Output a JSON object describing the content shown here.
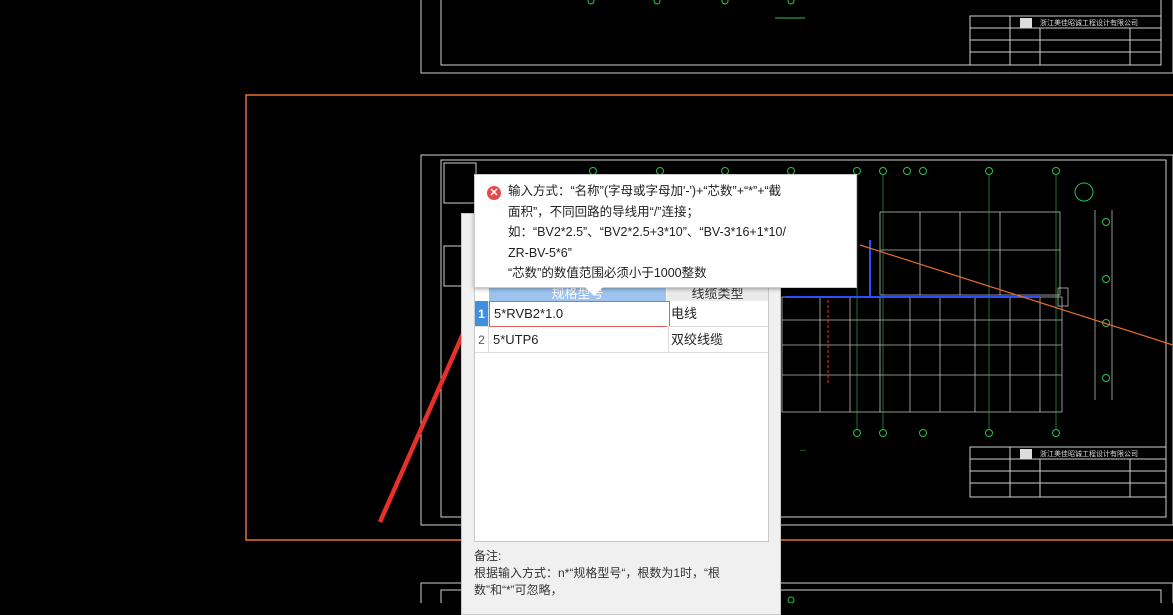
{
  "cad_titleblock": {
    "company": "浙江美佳昭诚工程设计有限公司"
  },
  "tooltip": {
    "icon": "error-icon",
    "lines": [
      "输入方式：“名称”(字母或字母加'-')+“芯数”+“*”+“截",
      "面积”，不同回路的导线用“/”连接；",
      "如：“BV2*2.5”、“BV2*2.5+3*10”、“BV-3*16+1*10/",
      "ZR-BV-5*6”",
      " “芯数”的数值范围必须小于1000整数"
    ]
  },
  "grid": {
    "headers": {
      "spec": "规格型号",
      "type": "线缆类型"
    },
    "rows": [
      {
        "num": "1",
        "spec": "5*RVB2*1.0",
        "type": "电线"
      },
      {
        "num": "2",
        "spec": "5*UTP6",
        "type": "双绞线缆"
      }
    ]
  },
  "note": {
    "title": "备注:",
    "line1": "根据输入方式：n*“规格型号“，根数为1时，“根",
    "line2": "数”和“*”可忽略，"
  },
  "colors": {
    "canvas": "#000000",
    "frame_orange": "#e8702a",
    "arrow_red": "#e8302a",
    "header_blue": "#9dc3ee",
    "selected_blue": "#3d8fe0"
  }
}
